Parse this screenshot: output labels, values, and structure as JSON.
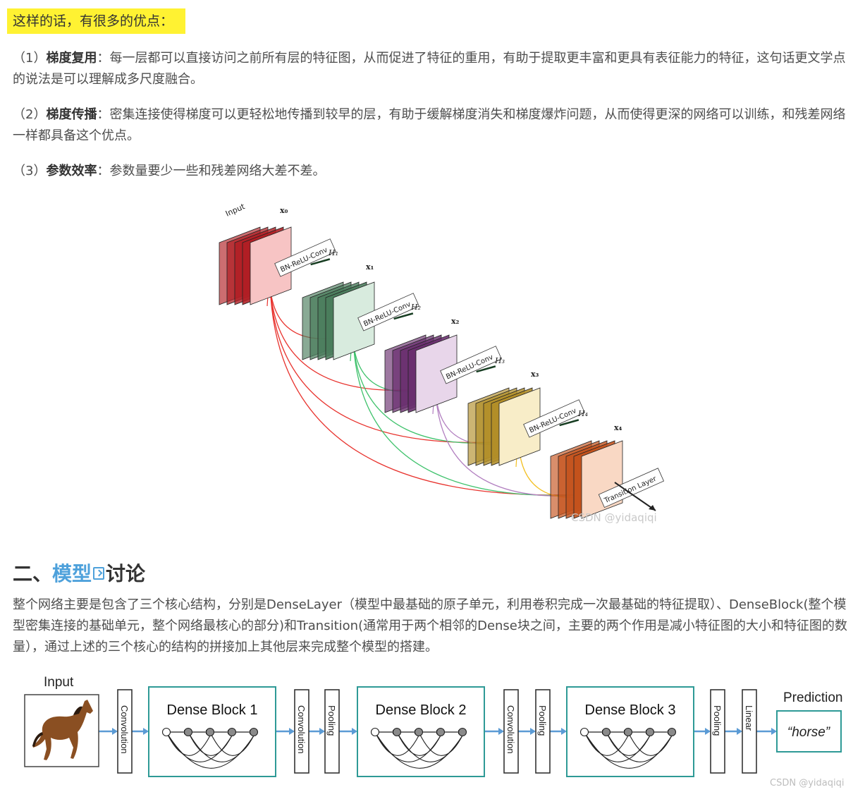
{
  "highlight_text": "这样的话，有很多的优点：",
  "points": [
    {
      "prefix": "（1）",
      "title": "梯度复用",
      "body": "：每一层都可以直接访问之前所有层的特征图，从而促进了特征的重用，有助于提取更丰富和更具有表征能力的特征，这句话更文学点的说法是可以理解成多尺度融合。"
    },
    {
      "prefix": "（2）",
      "title": "梯度传播",
      "body": "：密集连接使得梯度可以更轻松地传播到较早的层，有助于缓解梯度消失和梯度爆炸问题，从而使得更深的网络可以训练，和残差网络一样都具备这个优点。"
    },
    {
      "prefix": "（3）",
      "title": "参数效率",
      "body": "：参数量要少一些和残差网络大差不差。"
    }
  ],
  "figure1": {
    "input_label": "Input",
    "x_labels": [
      "x₀",
      "x₁",
      "x₂",
      "x₃",
      "x₄"
    ],
    "h_labels": [
      "H₁",
      "H₂",
      "H₃",
      "H₄"
    ],
    "op_label": "BN-ReLU-Conv",
    "transition_label": "Transition Layer",
    "watermark": "CSDN @yidaqiqi",
    "colors": [
      "#b01e24",
      "#4a7d5c",
      "#6a2f6f",
      "#b18e28",
      "#c4521c"
    ],
    "light_colors": [
      "#f7c4c4",
      "#d8ebde",
      "#e8d6ea",
      "#f8edc8",
      "#f9d8c4"
    ],
    "arc_colors": [
      "#e8332e",
      "#3fc26c",
      "#b27fc0",
      "#f3c024"
    ]
  },
  "section": {
    "prefix": "二、",
    "link_text": "模型",
    "icon": "search-link-icon",
    "suffix": "讨论"
  },
  "section_para": "整个网络主要是包含了三个核心结构，分别是DenseLayer（模型中最基础的原子单元，利用卷积完成一次最基础的特征提取）、DenseBlock(整个模型密集连接的基础单元，整个网络最核心的部分)和Transition(通常用于两个相邻的Dense块之间，主要的两个作用是减小特征图的大小和特征图的数量），通过上述的三个核心的结构的拼接加上其他层来完成整个模型的搭建。",
  "figure2": {
    "input_label": "Input",
    "blocks": [
      "Dense Block 1",
      "Dense Block 2",
      "Dense Block 3"
    ],
    "convolution": "Convolution",
    "pooling": "Pooling",
    "linear": "Linear",
    "prediction_label": "Prediction",
    "prediction_value": "“horse”",
    "watermark": "CSDN @yidaqiqi",
    "teal": "#2e9a96",
    "arrow": "#5b9bd5"
  }
}
